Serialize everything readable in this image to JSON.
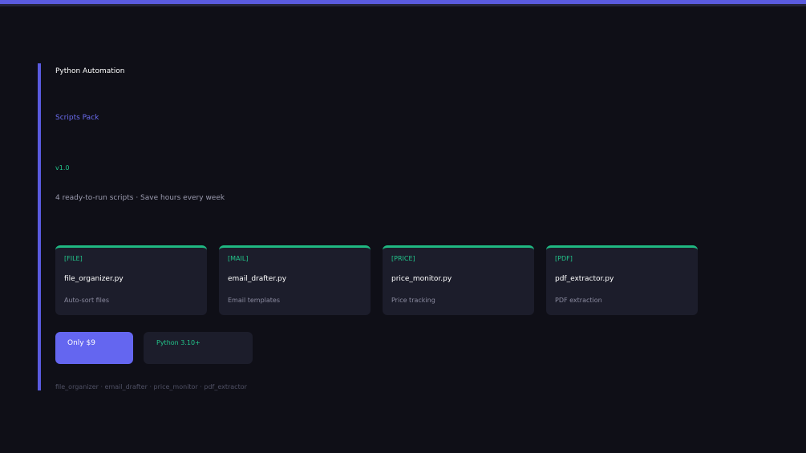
{
  "header": {
    "title": "Python Automation",
    "subtitle": "Scripts Pack",
    "version": "v1.0",
    "tagline": "4 ready-to-run scripts · Save hours every week"
  },
  "cards": [
    {
      "tag": "[FILE]",
      "name": "file_organizer.py",
      "desc": "Auto-sort files"
    },
    {
      "tag": "[MAIL]",
      "name": "email_drafter.py",
      "desc": "Email templates"
    },
    {
      "tag": "[PRICE]",
      "name": "price_monitor.py",
      "desc": "Price tracking"
    },
    {
      "tag": "[PDF]",
      "name": "pdf_extractor.py",
      "desc": "PDF extraction"
    }
  ],
  "cta": {
    "price_label": "Only $9",
    "python_label": "Python 3.10+"
  },
  "footer": {
    "text": "file_organizer · email_drafter · price_monitor · pdf_extractor"
  },
  "colors": {
    "background": "#0f0f17",
    "accent": "#5a5be0",
    "green": "#22c58b",
    "card": "#1c1d2b"
  }
}
